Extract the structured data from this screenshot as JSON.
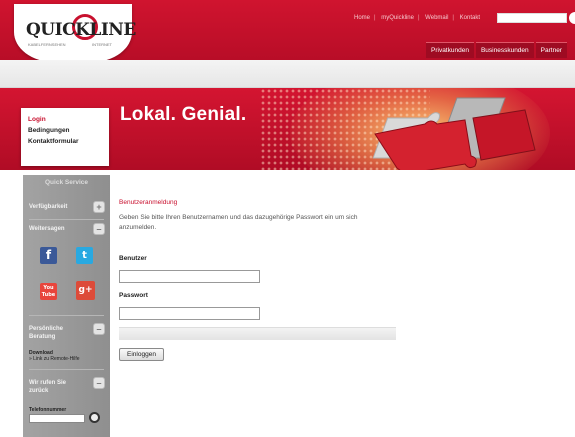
{
  "header": {
    "logo_text": "QUICKLINE",
    "logo_sub_left": "KABELFERNSEHEN",
    "logo_sub_right": "INTERNET",
    "topnav": [
      "Home",
      "myQuickline",
      "Webmail",
      "Kontakt"
    ],
    "tabs": [
      "Privatkunden",
      "Businesskunden",
      "Partner"
    ]
  },
  "banner": {
    "slogan": "Lokal. Genial."
  },
  "login_menu": {
    "items": [
      "Login",
      "Bedingungen",
      "Kontaktformular"
    ]
  },
  "sidebar": {
    "title": "Quick Service",
    "verfuegbarkeit": "Verfügbarkeit",
    "weitersagen": "Weitersagen",
    "beratung": "Persönliche Beratung",
    "download_title": "Download",
    "download_link": "» Link zu Remote-Hilfe",
    "rueckruf": "Wir rufen Sie zurück",
    "phone_label": "Telefonnummer",
    "toggle_plus": "+",
    "toggle_minus": "–",
    "social": [
      "f",
      "t",
      "You Tube",
      "g+"
    ]
  },
  "form": {
    "title": "Benutzeranmeldung",
    "intro": "Geben Sie bitte Ihren Benutzernamen und das dazugehörige Passwort ein um sich anzumelden.",
    "user_label": "Benutzer",
    "user_value": "",
    "pass_label": "Passwort",
    "pass_value": "",
    "submit_label": "Einloggen"
  },
  "colors": {
    "brand_red": "#c8102e",
    "sidebar_grey": "#9a9a9a"
  }
}
